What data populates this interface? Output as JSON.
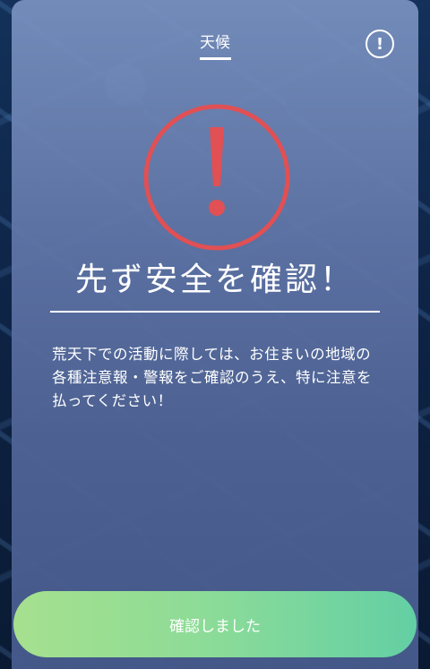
{
  "header": {
    "tab_label": "天候",
    "info_icon_glyph": "!"
  },
  "warning": {
    "icon": "exclamation-circle-icon",
    "icon_color": "#e05054",
    "headline": "先ず安全を確認！",
    "message": "荒天下での活動に際しては、お住まいの地域の各種注意報・警報をご確認のうえ、特に注意を払ってください！"
  },
  "footer": {
    "confirm_label": "確認しました"
  },
  "colors": {
    "panel_top": "#7a92c0",
    "panel_bottom": "#465a8c",
    "button_start": "#a6e08e",
    "button_end": "#63cfa4"
  }
}
